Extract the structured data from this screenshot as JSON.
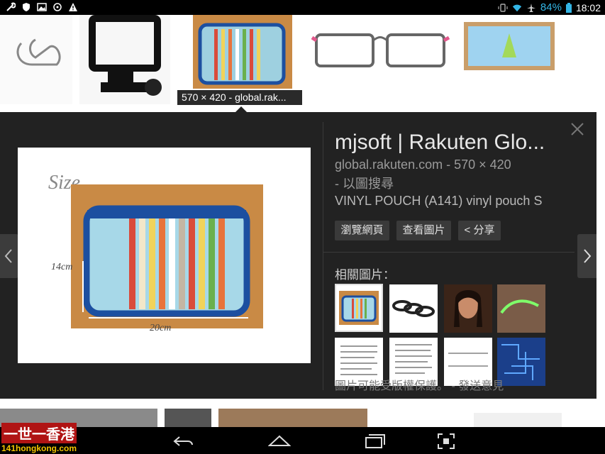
{
  "status_bar": {
    "battery_percent": "84%",
    "time": "18:02",
    "left_icons": [
      "wrench-icon",
      "shield-icon",
      "image-icon",
      "sync-icon",
      "warning-icon"
    ],
    "right_icons": [
      "vibrate-icon",
      "wifi-icon",
      "airplane-icon",
      "battery-icon"
    ],
    "accent_color": "#33b5e5"
  },
  "thumbnail_strip": {
    "selected_caption": "570 × 420 - global.rak..."
  },
  "detail": {
    "title": "mjsoft | Rakuten Glo...",
    "site_line": "global.rakuten.com - 570 × 420",
    "search_by_image": "- 以圖搜尋",
    "description": "VINYL POUCH (A141) vinyl pouch S",
    "buttons": {
      "browse": "瀏覽網頁",
      "view_image": "查看圖片",
      "share": "< 分享"
    },
    "related_label": "相關圖片：",
    "copyright_notice": "圖片可能受版權保護。 - 發送意見",
    "preview_annotations": {
      "size_label": "Size",
      "height_label": "14cm",
      "width_label": "20cm"
    }
  },
  "watermark": {
    "line1": "一世一香港",
    "line2": "141hongkong.com"
  }
}
